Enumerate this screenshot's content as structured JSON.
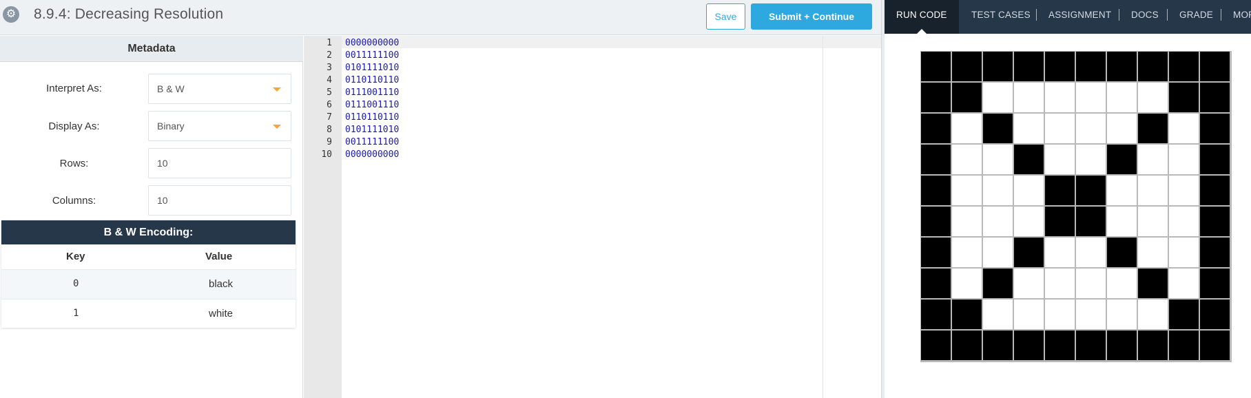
{
  "header": {
    "title": "8.9.4: Decreasing Resolution",
    "save_label": "Save",
    "submit_label": "Submit + Continue",
    "icon": "gear-icon"
  },
  "metadata": {
    "heading": "Metadata",
    "interpret_label": "Interpret As:",
    "interpret_value": "B & W",
    "display_label": "Display As:",
    "display_value": "Binary",
    "rows_label": "Rows:",
    "rows_value": "10",
    "columns_label": "Columns:",
    "columns_value": "10"
  },
  "encoding": {
    "heading": "B & W Encoding:",
    "key_header": "Key",
    "value_header": "Value",
    "rows": [
      {
        "key": "0",
        "value": "black"
      },
      {
        "key": "1",
        "value": "white"
      }
    ]
  },
  "editor": {
    "lines": [
      {
        "num": "1",
        "text": "0000000000"
      },
      {
        "num": "2",
        "text": "0011111100"
      },
      {
        "num": "3",
        "text": "0101111010"
      },
      {
        "num": "4",
        "text": "0110110110"
      },
      {
        "num": "5",
        "text": "0111001110"
      },
      {
        "num": "6",
        "text": "0111001110"
      },
      {
        "num": "7",
        "text": "0110110110"
      },
      {
        "num": "8",
        "text": "0101111010"
      },
      {
        "num": "9",
        "text": "0011111100"
      },
      {
        "num": "10",
        "text": "0000000000"
      }
    ]
  },
  "tabs": [
    {
      "label": "RUN CODE",
      "active": true
    },
    {
      "label": "TEST CASES"
    },
    {
      "label": "ASSIGNMENT"
    },
    {
      "label": "DOCS"
    },
    {
      "label": "GRADE"
    },
    {
      "label": "MOR"
    }
  ],
  "colors": {
    "accent": "#2ea9df",
    "dark_nav": "#26374a",
    "caret": "#f0a830",
    "pixel_black": "#000000",
    "pixel_white": "#ffffff"
  }
}
